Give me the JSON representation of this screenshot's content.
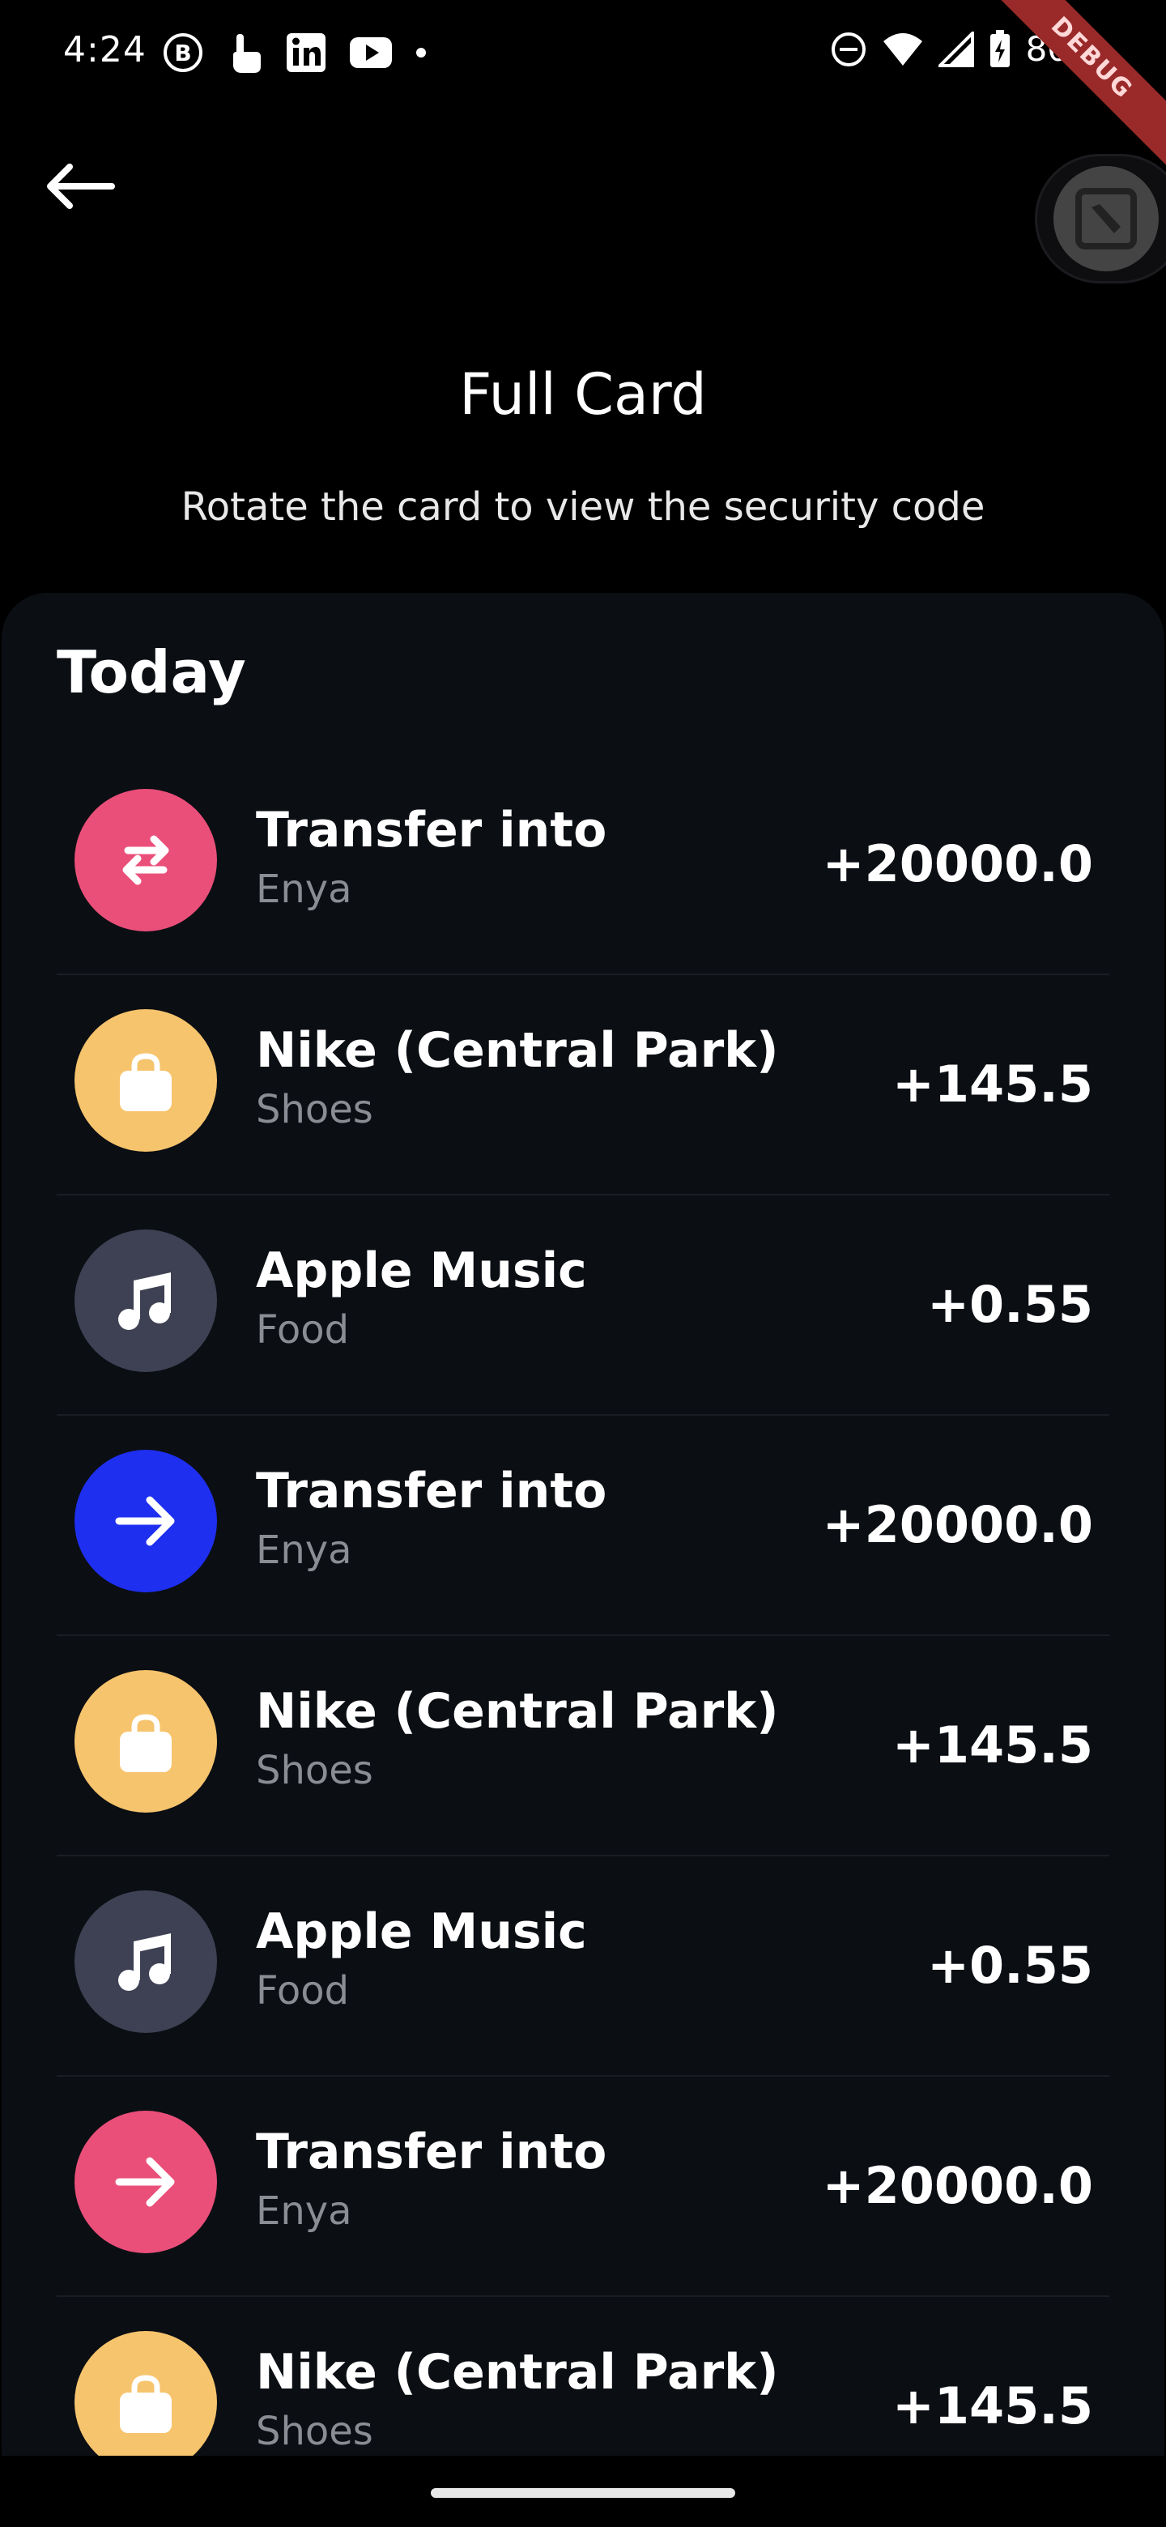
{
  "status": {
    "time": "4:24",
    "battery": "80%",
    "debug_label": "DEBUG",
    "left_icons": [
      "b-circle-icon",
      "touch-icon",
      "linkedin-icon",
      "youtube-icon",
      "dot-icon"
    ],
    "right_icons": [
      "dnd-icon",
      "wifi-icon",
      "signal-icon",
      "battery-icon"
    ]
  },
  "header": {
    "title": "Full Card",
    "subtitle": "Rotate the card to view the security code"
  },
  "section": {
    "title": "Today"
  },
  "transactions": [
    {
      "title": "Transfer into",
      "subtitle": "Enya",
      "amount": "+20000.0",
      "icon": "transfer-icon",
      "color": "#ea4f7a"
    },
    {
      "title": "Nike (Central Park)",
      "subtitle": "Shoes",
      "amount": "+145.5",
      "icon": "shopping-bag-icon",
      "color": "#f6c46d"
    },
    {
      "title": "Apple Music",
      "subtitle": "Food",
      "amount": "+0.55",
      "icon": "music-note-icon",
      "color": "#3e4153"
    },
    {
      "title": "Transfer into",
      "subtitle": "Enya",
      "amount": "+20000.0",
      "icon": "arrow-right-icon",
      "color": "#1e2ff0"
    },
    {
      "title": "Nike (Central Park)",
      "subtitle": "Shoes",
      "amount": "+145.5",
      "icon": "shopping-bag-icon",
      "color": "#f6c46d"
    },
    {
      "title": "Apple Music",
      "subtitle": "Food",
      "amount": "+0.55",
      "icon": "music-note-icon",
      "color": "#3e4153"
    },
    {
      "title": "Transfer into",
      "subtitle": "Enya",
      "amount": "+20000.0",
      "icon": "arrow-right-icon",
      "color": "#ea4f7a"
    },
    {
      "title": "Nike (Central Park)",
      "subtitle": "Shoes",
      "amount": "+145.5",
      "icon": "shopping-bag-icon",
      "color": "#f6c46d"
    }
  ]
}
